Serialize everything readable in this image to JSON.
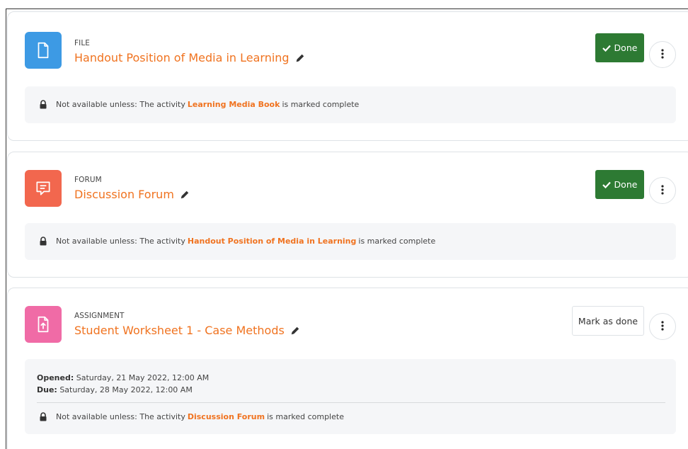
{
  "activities": [
    {
      "type": "FILE",
      "title": "Handout Position of Media in Learning",
      "icon": "file-icon",
      "icon_color": "#3d9ae4",
      "completion": "Done",
      "restriction": {
        "prefix": "Not available unless: The activity",
        "activity": "Learning Media Book",
        "suffix": "is marked complete"
      }
    },
    {
      "type": "FORUM",
      "title": "Discussion Forum",
      "icon": "forum-icon",
      "icon_color": "#f2674e",
      "completion": "Done",
      "restriction": {
        "prefix": "Not available unless: The activity",
        "activity": "Handout Position of Media in Learning",
        "suffix": "is marked complete"
      }
    },
    {
      "type": "ASSIGNMENT",
      "title": "Student Worksheet 1 - Case Methods",
      "icon": "assignment-icon",
      "icon_color": "#f06ba6",
      "completion": "Mark as done",
      "dates": {
        "opened_label": "Opened:",
        "opened_value": "Saturday, 21 May 2022, 12:00 AM",
        "due_label": "Due:",
        "due_value": "Saturday, 28 May 2022, 12:00 AM"
      },
      "restriction": {
        "prefix": "Not available unless: The activity",
        "activity": "Discussion Forum",
        "suffix": "is marked complete"
      }
    }
  ],
  "colors": {
    "accent": "#f07320",
    "done_button": "#2d7a33"
  }
}
